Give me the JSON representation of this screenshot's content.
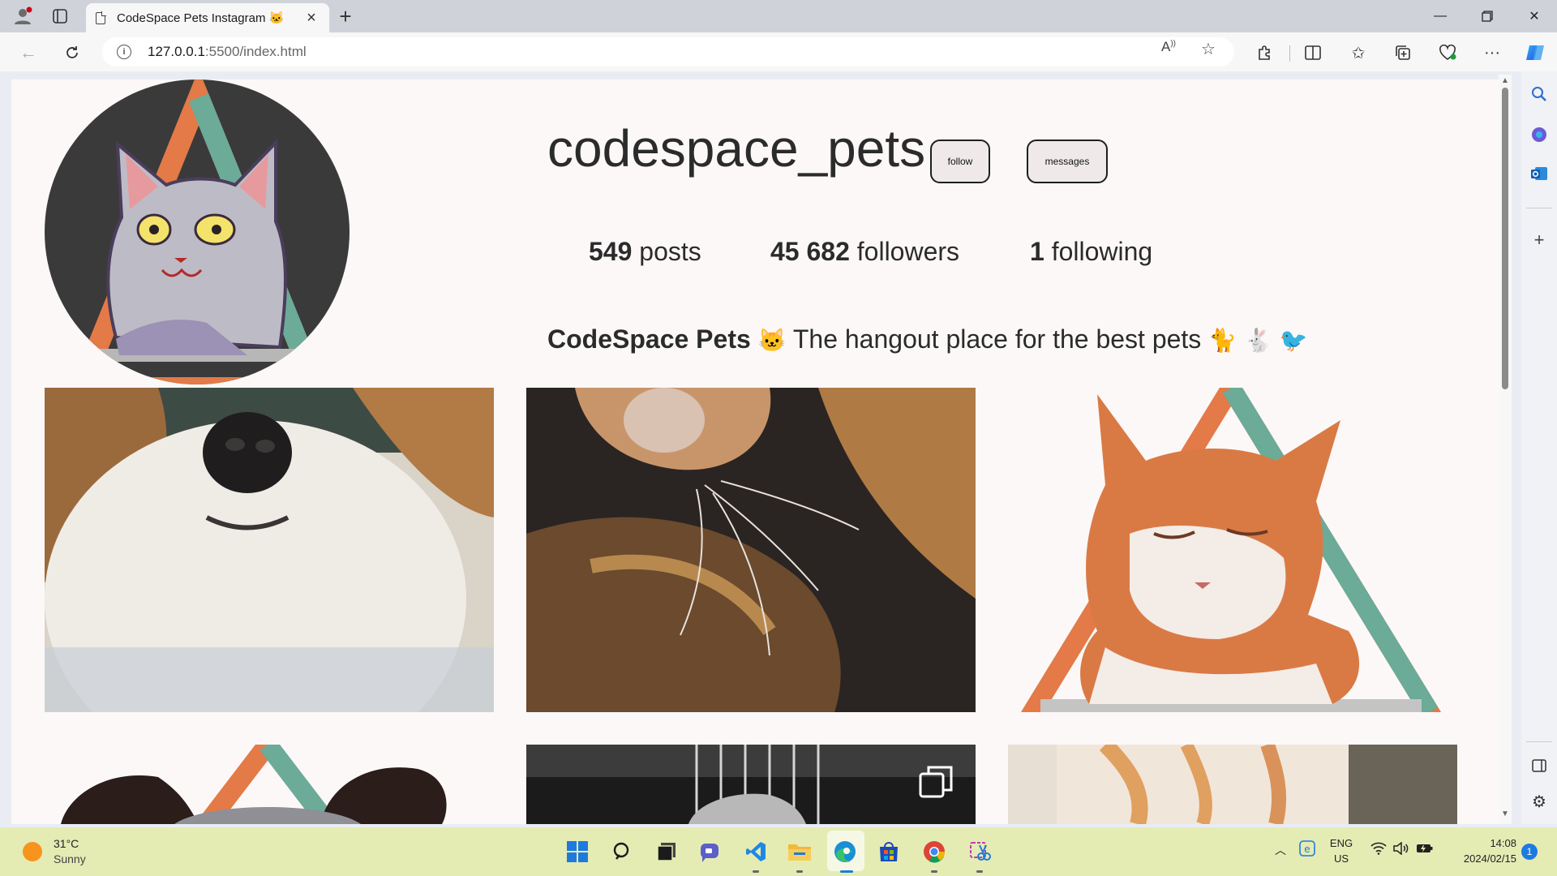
{
  "browser": {
    "tab_title": "CodeSpace Pets Instagram 🐱",
    "url_host": "127.0.0.1",
    "url_path": ":5500/index.html"
  },
  "profile": {
    "username": "codespace_pets",
    "follow_label": "follow",
    "messages_label": "messages",
    "stats": [
      {
        "value": "549",
        "label": "posts"
      },
      {
        "value": "45 682",
        "label": "followers"
      },
      {
        "value": "1",
        "label": "following"
      }
    ],
    "bio_name": "CodeSpace Pets",
    "bio_text": "The hangout place for the best pets",
    "bio_emojis": [
      "🐱",
      "🐈",
      "🐇",
      "🐦"
    ]
  },
  "posts": [
    {
      "subject": "dog-closeup"
    },
    {
      "subject": "calico-cat"
    },
    {
      "subject": "ginger-cat-logo"
    },
    {
      "subject": "dog-logo"
    },
    {
      "subject": "bw-dog-gallery"
    },
    {
      "subject": "ginger-cat-blanket"
    }
  ],
  "taskbar": {
    "temperature": "31°C",
    "weather": "Sunny",
    "lang": "ENG",
    "region": "US",
    "time": "14:08",
    "date": "2024/02/15",
    "notifications": "1"
  }
}
